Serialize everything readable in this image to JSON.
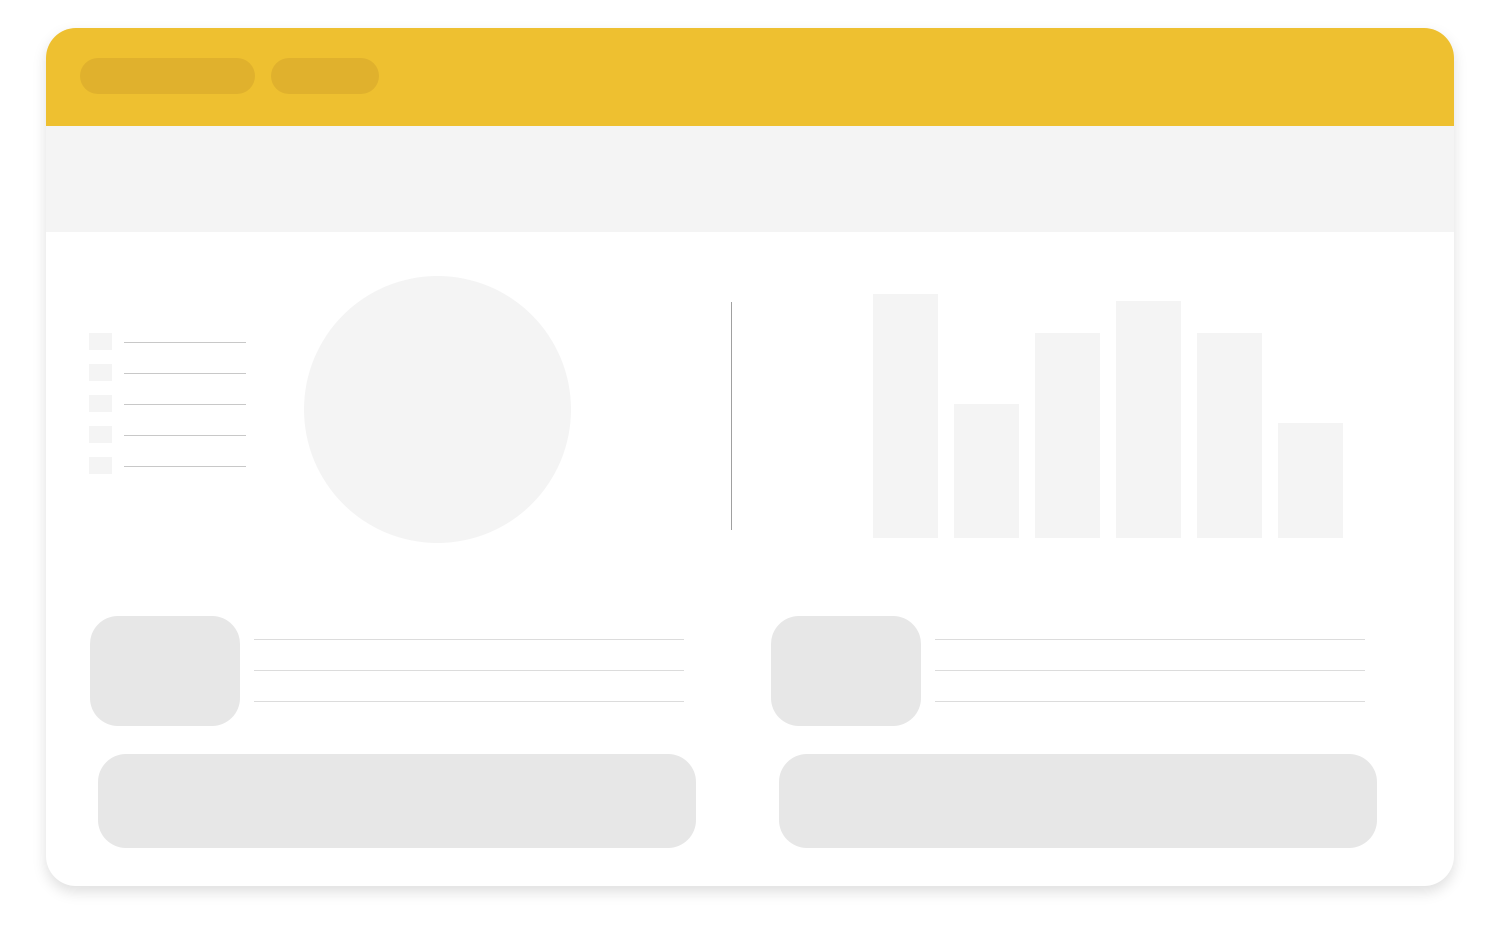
{
  "colors": {
    "header": "#eec030",
    "header_pill": "#e0b12d",
    "subheader": "#f4f4f4",
    "placeholder_light": "#f4f4f4",
    "placeholder_medium": "#e7e7e7"
  },
  "header": {
    "tabs": [
      {
        "label": ""
      },
      {
        "label": ""
      }
    ]
  },
  "legend": {
    "items": [
      {
        "label": ""
      },
      {
        "label": ""
      },
      {
        "label": ""
      },
      {
        "label": ""
      },
      {
        "label": ""
      }
    ]
  },
  "chart_data": [
    {
      "type": "pie",
      "values": [
        1
      ],
      "title": ""
    },
    {
      "type": "bar",
      "values": [
        100,
        55,
        84,
        97,
        84,
        47
      ],
      "ylim": [
        0,
        100
      ],
      "title": "",
      "xlabel": "",
      "ylabel": ""
    }
  ],
  "cards": [
    {
      "lines": [
        "",
        "",
        ""
      ],
      "button_label": ""
    },
    {
      "lines": [
        "",
        "",
        ""
      ],
      "button_label": ""
    }
  ]
}
